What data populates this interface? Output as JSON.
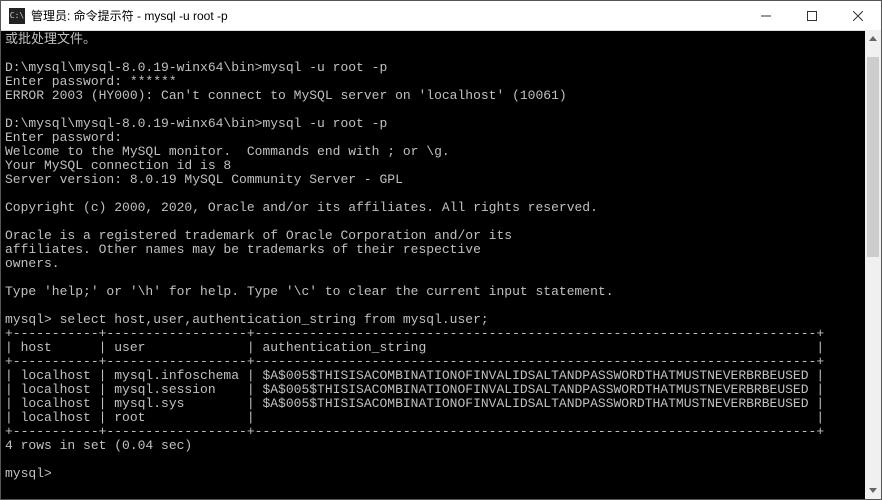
{
  "window": {
    "title": "管理员: 命令提示符 - mysql  -u root -p"
  },
  "term": {
    "line0": "或批处理文件。",
    "blank": "",
    "prompt1": "D:\\mysql\\mysql-8.0.19-winx64\\bin>mysql -u root -p",
    "enter_pw1": "Enter password: ******",
    "error1": "ERROR 2003 (HY000): Can't connect to MySQL server on 'localhost' (10061)",
    "prompt2": "D:\\mysql\\mysql-8.0.19-winx64\\bin>mysql -u root -p",
    "enter_pw2": "Enter password:",
    "welcome": "Welcome to the MySQL monitor.  Commands end with ; or \\g.",
    "conn_id": "Your MySQL connection id is 8",
    "server_ver": "Server version: 8.0.19 MySQL Community Server - GPL",
    "copyright": "Copyright (c) 2000, 2020, Oracle and/or its affiliates. All rights reserved.",
    "tm1": "Oracle is a registered trademark of Oracle Corporation and/or its",
    "tm2": "affiliates. Other names may be trademarks of their respective",
    "tm3": "owners.",
    "help": "Type 'help;' or '\\h' for help. Type '\\c' to clear the current input statement.",
    "query": "mysql> select host,user,authentication_string from mysql.user;",
    "hr": "+-----------+------------------+------------------------------------------------------------------------+",
    "hdr": "| host      | user             | authentication_string                                                  |",
    "r1": "| localhost | mysql.infoschema | $A$005$THISISACOMBINATIONOFINVALIDSALTANDPASSWORDTHATMUSTNEVERBRBEUSED |",
    "r2": "| localhost | mysql.session    | $A$005$THISISACOMBINATIONOFINVALIDSALTANDPASSWORDTHATMUSTNEVERBRBEUSED |",
    "r3": "| localhost | mysql.sys        | $A$005$THISISACOMBINATIONOFINVALIDSALTANDPASSWORDTHATMUSTNEVERBRBEUSED |",
    "r4": "| localhost | root             |                                                                        |",
    "rows_count": "4 rows in set (0.04 sec)",
    "mysql_prompt": "mysql> "
  },
  "chart_data": {
    "type": "table",
    "title": "select host,user,authentication_string from mysql.user",
    "columns": [
      "host",
      "user",
      "authentication_string"
    ],
    "rows": [
      [
        "localhost",
        "mysql.infoschema",
        "$A$005$THISISACOMBINATIONOFINVALIDSALTANDPASSWORDTHATMUSTNEVERBRBEUSED"
      ],
      [
        "localhost",
        "mysql.session",
        "$A$005$THISISACOMBINATIONOFINVALIDSALTANDPASSWORDTHATMUSTNEVERBRBEUSED"
      ],
      [
        "localhost",
        "mysql.sys",
        "$A$005$THISISACOMBINATIONOFINVALIDSALTANDPASSWORDTHATMUSTNEVERBRBEUSED"
      ],
      [
        "localhost",
        "root",
        ""
      ]
    ],
    "row_count_text": "4 rows in set (0.04 sec)"
  }
}
